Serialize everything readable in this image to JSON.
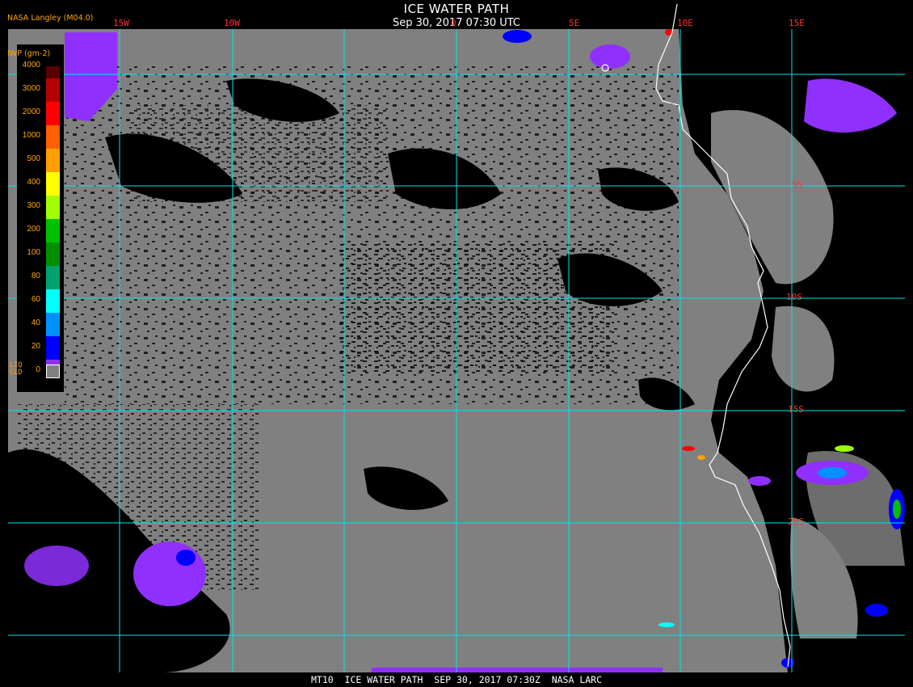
{
  "title": "ICE WATER PATH",
  "datetime": "Sep 30, 2017 07:30 UTC",
  "footer": "MT10  ICE WATER PATH  SEP 30, 2017 07:30Z  NASA LARC",
  "lon_labels": [
    "15W",
    "10W",
    "0",
    "5E",
    "10E",
    "15E"
  ],
  "lat_labels": [
    "5S",
    "10S",
    "15S",
    "20S"
  ],
  "legend": {
    "org": "NASA Langley (M04.0)",
    "units": "IWP (gm-2)",
    "values": [
      "4000",
      "3000",
      "2000",
      "1000",
      "500",
      "400",
      "300",
      "200",
      "100",
      "80",
      "60",
      "40",
      "20",
      "0"
    ],
    "colors": [
      "#5a0000",
      "#b40000",
      "#ff0000",
      "#ff6000",
      "#ffa000",
      "#ffff00",
      "#a0ff00",
      "#00c000",
      "#009000",
      "#00a070",
      "#00ffff",
      "#0090ff",
      "#0000ff",
      "#9030ff"
    ],
    "liq_label": "LIQ\nCLD",
    "liq_color": "#808080"
  },
  "colors": {
    "background_water": "#808080",
    "cloud_free": "#000000",
    "grid": "#00e5ee",
    "coastline": "#ffffff",
    "grid_label": "#ff3030"
  }
}
